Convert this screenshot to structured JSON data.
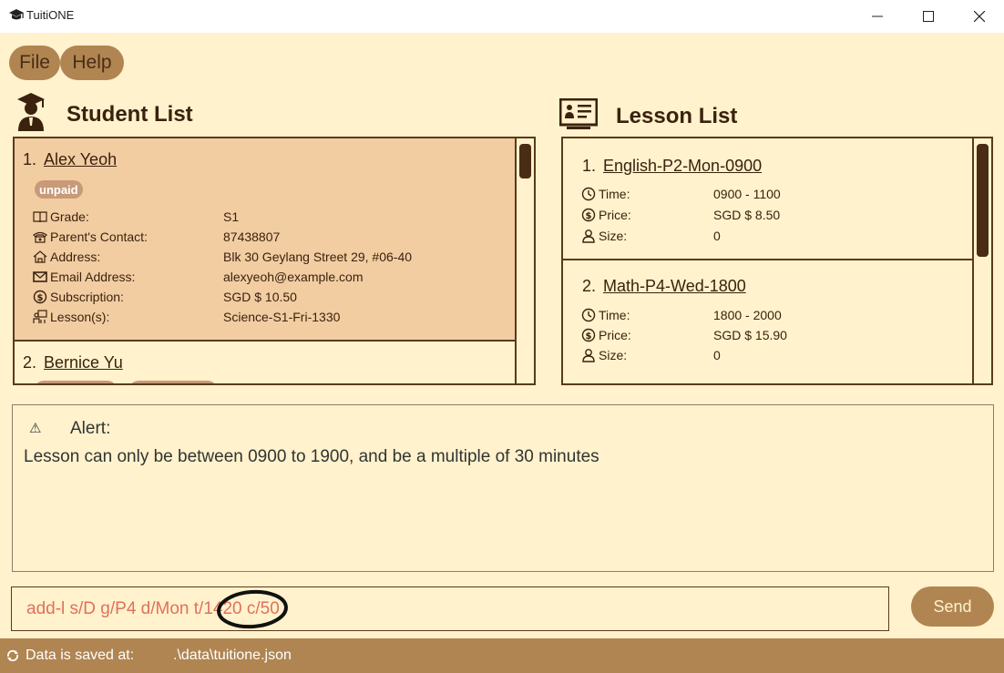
{
  "window": {
    "title": "TuitiONE"
  },
  "menu": {
    "file": "File",
    "help": "Help"
  },
  "students": {
    "title": "Student List",
    "items": [
      {
        "index": "1.",
        "name": "Alex Yeoh",
        "tags": [
          "unpaid"
        ],
        "grade_label": "Grade:",
        "grade": "S1",
        "contact_label": "Parent's Contact:",
        "contact": "87438807",
        "address_label": "Address:",
        "address": "Blk 30 Geylang Street 29, #06-40",
        "email_label": "Email Address:",
        "email": "alexyeoh@example.com",
        "subscription_label": "Subscription:",
        "subscription": "SGD $ 10.50",
        "lessons_label": "Lesson(s):",
        "lessons": "Science-S1-Fri-1330"
      },
      {
        "index": "2.",
        "name": "Bernice Yu"
      }
    ]
  },
  "lessons": {
    "title": "Lesson List",
    "items": [
      {
        "index": "1.",
        "name": "English-P2-Mon-0900",
        "time_label": "Time:",
        "time": "0900 - 1100",
        "price_label": "Price:",
        "price": "SGD $ 8.50",
        "size_label": "Size:",
        "size": "0"
      },
      {
        "index": "2.",
        "name": "Math-P4-Wed-1800",
        "time_label": "Time:",
        "time": "1800 - 2000",
        "price_label": "Price:",
        "price": "SGD $ 15.90",
        "size_label": "Size:",
        "size": "0"
      }
    ]
  },
  "alert": {
    "label": "Alert:",
    "message": "Lesson can only be between 0900 to 1900, and be a multiple of 30 minutes"
  },
  "command": {
    "value": "add-l s/D g/P4 d/Mon t/1420 c/50",
    "send_label": "Send"
  },
  "status": {
    "label": "Data is saved at:",
    "path": ".\\data\\tuitione.json"
  },
  "colors": {
    "accent": "#b08552",
    "background": "#fff2cc",
    "selected_card": "#f2cda2",
    "error_text": "#e07060",
    "dark": "#4a2c14"
  }
}
